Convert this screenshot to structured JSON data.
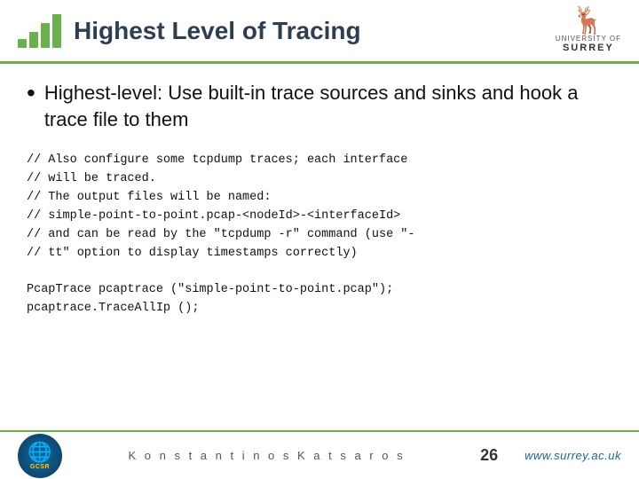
{
  "header": {
    "title": "Highest Level of Tracing",
    "logo_bars": [
      "bar1",
      "bar2",
      "bar3",
      "bar4"
    ],
    "surrey_deer": "🦌",
    "surrey_line1": "UNIVERSITY OF",
    "surrey_line2": "SURREY"
  },
  "bullet": {
    "text": "Highest-level: Use built-in trace sources and sinks and hook a trace file to them"
  },
  "code": {
    "lines": [
      "// Also configure some tcpdump traces; each interface",
      "// will be traced.",
      "// The output files will be named:",
      "// simple-point-to-point.pcap-<nodeId>-<interfaceId>",
      "// and can be read by the \"tcpdump -r\" command (use \"-",
      "// tt\" option to display timestamps correctly)"
    ],
    "code_lines": [
      "PcapTrace pcaptrace (\"simple-point-to-point.pcap\");",
      "pcaptrace.TraceAllIp ();"
    ]
  },
  "footer": {
    "name": "K o n s t a n t i n o s   K a t s a r o s",
    "page": "26",
    "url": "www.surrey.ac.uk",
    "gcsr_label": "GCSR"
  }
}
